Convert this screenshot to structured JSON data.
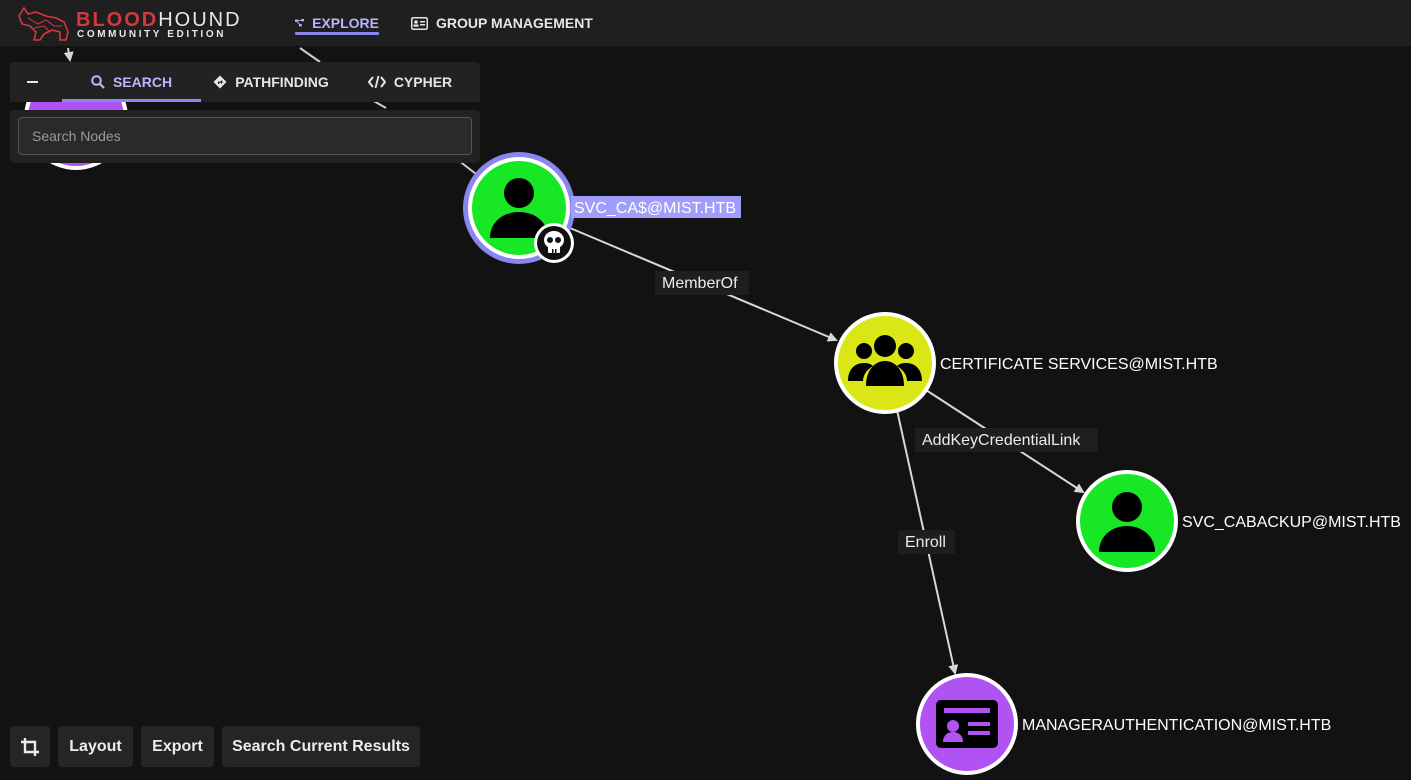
{
  "app": {
    "logo": {
      "main_red": "BLOOD",
      "main_white": "HOUND",
      "sub": "COMMUNITY EDITION"
    },
    "nav": [
      {
        "label": "EXPLORE",
        "icon": "graph-nodes-icon",
        "active": true
      },
      {
        "label": "GROUP MANAGEMENT",
        "icon": "id-card-icon",
        "active": false
      }
    ]
  },
  "search_panel": {
    "tabs": [
      {
        "label": "SEARCH",
        "icon": "search-icon",
        "active": true
      },
      {
        "label": "PATHFINDING",
        "icon": "route-icon",
        "active": false
      },
      {
        "label": "CYPHER",
        "icon": "code-icon",
        "active": false
      }
    ],
    "search_placeholder": "Search Nodes",
    "search_value": ""
  },
  "graph": {
    "nodes": [
      {
        "id": "svc_ca",
        "label": "SVC_CA$@MIST.HTB",
        "type": "user",
        "selected": true,
        "badge": "skull-icon"
      },
      {
        "id": "cert_services",
        "label": "CERTIFICATE SERVICES@MIST.HTB",
        "type": "group"
      },
      {
        "id": "svc_cabackup",
        "label": "SVC_CABACKUP@MIST.HTB",
        "type": "user"
      },
      {
        "id": "manager_auth",
        "label": "MANAGERAUTHENTICATION@MIST.HTB",
        "type": "cert-template"
      }
    ],
    "edges": [
      {
        "from": "svc_ca",
        "to": "cert_services",
        "label": "MemberOf"
      },
      {
        "from": "cert_services",
        "to": "svc_cabackup",
        "label": "AddKeyCredentialLink"
      },
      {
        "from": "cert_services",
        "to": "manager_auth",
        "label": "Enroll"
      }
    ]
  },
  "controls": {
    "crop_icon": "crop-icon",
    "layout_label": "Layout",
    "export_label": "Export",
    "search_results_label": "Search Current Results"
  },
  "colors": {
    "user": "#17e725",
    "group": "#dbe617",
    "cert_template": "#b153f3",
    "accent": "#8a86f0",
    "selected_label_bg": "#a19dfa",
    "brand_red": "#d8363e"
  }
}
